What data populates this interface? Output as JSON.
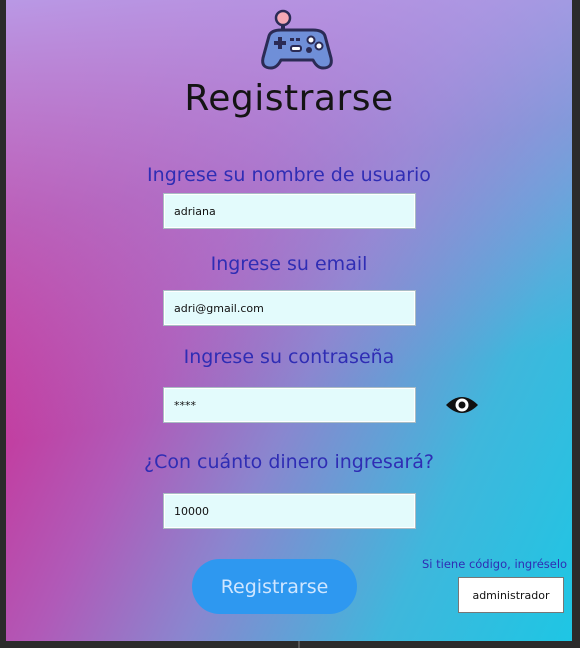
{
  "header": {
    "title": "Registrarse",
    "logo_icon": "gamepad-icon"
  },
  "form": {
    "username_label": "Ingrese su nombre de usuario",
    "username_value": "adriana",
    "email_label": "Ingrese su email",
    "email_value": "adri@gmail.com",
    "password_label": "Ingrese su contraseña",
    "password_value": "****",
    "password_toggle_icon": "eye-icon",
    "money_label": "¿Con cuánto dinero ingresará?",
    "money_value": "10000",
    "submit_label": "Registrarse"
  },
  "admin": {
    "hint": "Si tiene código, ingréselo",
    "code_value": "administrador"
  },
  "colors": {
    "label": "#2f2db4",
    "button": "#2e98f0",
    "field_bg": "#e3fbfc"
  }
}
